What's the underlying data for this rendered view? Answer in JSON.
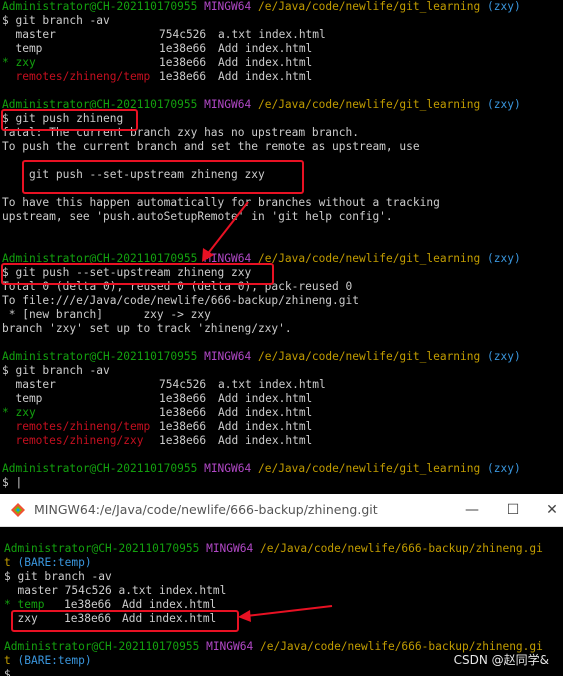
{
  "t1": {
    "l1": {
      "user": "Administrator@CH-202110170955",
      "sys": "MINGW64",
      "path": "/e/Java/code/newlife/git_learning",
      "branch": "(zxy)"
    },
    "l2": "$ git branch -av",
    "l3": {
      "name": "  master",
      "hash": "754c526",
      "msg": "a.txt index.html"
    },
    "l4": {
      "name": "  temp",
      "hash": "1e38e66",
      "msg": "Add index.html"
    },
    "l5": {
      "star": "*",
      "name": " zxy",
      "hash": "1e38e66",
      "msg": "Add index.html"
    },
    "l6": {
      "name": "  remotes/zhineng/temp",
      "hash": "1e38e66",
      "msg": "Add index.html"
    },
    "l8": {
      "user": "Administrator@CH-202110170955",
      "sys": "MINGW64",
      "path": "/e/Java/code/newlife/git_learning",
      "branch": "(zxy)"
    },
    "l9": "$ git push zhineng",
    "l10": "fatal: The current branch zxy has no upstream branch.",
    "l11": "To push the current branch and set the remote as upstream, use",
    "l13": "    git push --set-upstream zhineng zxy",
    "l15": "To have this happen automatically for branches without a tracking",
    "l16": "upstream, see 'push.autoSetupRemote' in 'git help config'.",
    "l19": {
      "user": "Administrator@CH-202110170955",
      "sys": "MINGW64",
      "path": "/e/Java/code/newlife/git_learning",
      "branch": "(zxy)"
    },
    "l20": "$ git push --set-upstream zhineng zxy",
    "l21": "Total 0 (delta 0), reused 0 (delta 0), pack-reused 0",
    "l22": "To file:///e/Java/code/newlife/666-backup/zhineng.git",
    "l23": " * [new branch]      zxy -> zxy",
    "l24": "branch 'zxy' set up to track 'zhineng/zxy'.",
    "l26": {
      "user": "Administrator@CH-202110170955",
      "sys": "MINGW64",
      "path": "/e/Java/code/newlife/git_learning",
      "branch": "(zxy)"
    },
    "l27": "$ git branch -av",
    "l28": {
      "name": "  master",
      "hash": "754c526",
      "msg": "a.txt index.html"
    },
    "l29": {
      "name": "  temp",
      "hash": "1e38e66",
      "msg": "Add index.html"
    },
    "l30": {
      "star": "*",
      "name": " zxy",
      "hash": "1e38e66",
      "msg": "Add index.html"
    },
    "l31": {
      "name": "  remotes/zhineng/temp",
      "hash": "1e38e66",
      "msg": "Add index.html"
    },
    "l32": {
      "name": "  remotes/zhineng/zxy",
      "hash": "1e38e66",
      "msg": "Add index.html"
    },
    "l34": {
      "user": "Administrator@CH-202110170955",
      "sys": "MINGW64",
      "path": "/e/Java/code/newlife/git_learning",
      "branch": "(zxy)"
    },
    "l35": "$ |"
  },
  "w2": {
    "title": "MINGW64:/e/Java/code/newlife/666-backup/zhineng.git",
    "min": "—",
    "max": "☐",
    "close": "✕",
    "p1": {
      "user": "Administrator@CH-202110170955",
      "sys": "MINGW64",
      "path": "/e/Java/code/newlife/666-backup/zhineng.gi",
      "wrap": "t",
      "branch": "(BARE:temp)"
    },
    "cmd": "$ git branch -av",
    "b1": {
      "name": "  master",
      "hash": "754c526",
      "msg": "a.txt index.html"
    },
    "b2": {
      "star": "*",
      "name": " temp",
      "hash": "1e38e66",
      "msg": "Add index.html"
    },
    "b3": {
      "name": "  zxy",
      "hash": "1e38e66",
      "msg": "Add index.html"
    },
    "p2": {
      "user": "Administrator@CH-202110170955",
      "sys": "MINGW64",
      "path": "/e/Java/code/newlife/666-backup/zhineng.gi",
      "wrap": "t",
      "branch": "(BARE:temp)"
    },
    "last": "$"
  },
  "watermark": "CSDN @赵同学&",
  "colors": {
    "green": "#13a10e",
    "magenta": "#b148c6",
    "yellow": "#c19c00",
    "cyan": "#3a96dd",
    "red": "#c50f1f",
    "annotation": "#e81123"
  },
  "icons": {
    "window": "git-bash-diamond-icon"
  }
}
